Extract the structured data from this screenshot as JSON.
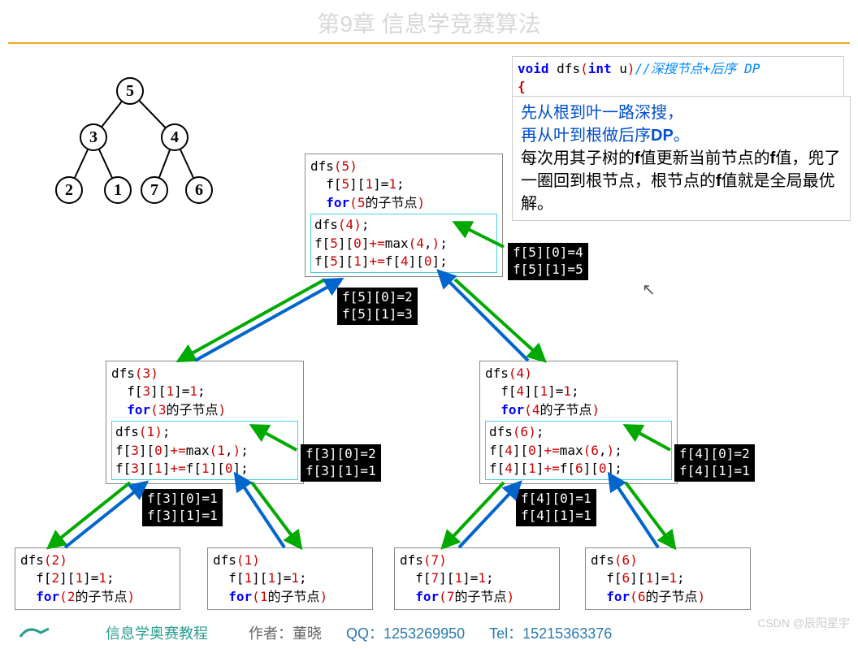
{
  "title": "第9章 信息学竞赛算法",
  "tree": {
    "root": "5",
    "left": "3",
    "right": "4",
    "ll": "2",
    "lr": "1",
    "rl": "7",
    "rr": "6"
  },
  "code_top": {
    "sig": "void dfs(int u)",
    "comment": "//深搜节点+后序 DP",
    "brace": "{"
  },
  "note": {
    "l1": "先从根到叶一路深搜，",
    "l2a": "再从叶到根做后序",
    "l2b": "DP",
    "l2c": "。",
    "l3a": "每次用其子树的",
    "l3b": "f",
    "l3c": "值更新当前节点的",
    "l3d": "f",
    "l3e": "值，兜了一圈回到根节点，根节点的",
    "l3f": "f",
    "l3g": "值就是全局最优解。"
  },
  "dfs5": {
    "h": "dfs(5)",
    "l1": "f[5][1]=1;",
    "l2a": "for",
    "l2b": "(5的子节点)",
    "in1": "dfs(4);",
    "in2": "f[5][0]+=max(4,);",
    "in3": "f[5][1]+=f[4][0];"
  },
  "black5a": {
    "l1": "f[5][0]=4",
    "l2": "f[5][1]=5"
  },
  "black5b": {
    "l1": "f[5][0]=2",
    "l2": "f[5][1]=3"
  },
  "dfs3": {
    "h": "dfs(3)",
    "l1": "f[3][1]=1;",
    "l2a": "for",
    "l2b": "(3的子节点)",
    "in1": "dfs(1);",
    "in2": "f[3][0]+=max(1,);",
    "in3": "f[3][1]+=f[1][0];"
  },
  "black3a": {
    "l1": "f[3][0]=2",
    "l2": "f[3][1]=1"
  },
  "black3b": {
    "l1": "f[3][0]=1",
    "l2": "f[3][1]=1"
  },
  "dfs4": {
    "h": "dfs(4)",
    "l1": "f[4][1]=1;",
    "l2a": "for",
    "l2b": "(4的子节点)",
    "in1": "dfs(6);",
    "in2": "f[4][0]+=max(6,);",
    "in3": "f[4][1]+=f[6][0];"
  },
  "black4a": {
    "l1": "f[4][0]=2",
    "l2": "f[4][1]=1"
  },
  "black4b": {
    "l1": "f[4][0]=1",
    "l2": "f[4][1]=1"
  },
  "dfs2": {
    "h": "dfs(2)",
    "l1": "f[2][1]=1;",
    "l2a": "for",
    "l2b": "(2的子节点)"
  },
  "dfs1": {
    "h": "dfs(1)",
    "l1": "f[1][1]=1;",
    "l2a": "for",
    "l2b": "(1的子节点)"
  },
  "dfs7": {
    "h": "dfs(7)",
    "l1": "f[7][1]=1;",
    "l2a": "for",
    "l2b": "(7的子节点)"
  },
  "dfs6": {
    "h": "dfs(6)",
    "l1": "f[6][1]=1;",
    "l2a": "for",
    "l2b": "(6的子节点)"
  },
  "footer": {
    "brand": "信息学奥赛教程",
    "author_label": "作者：",
    "author": "董晓",
    "qq_label": "QQ：",
    "qq": "1253269950",
    "tel_label": "Tel：",
    "tel": "15215363376"
  },
  "watermark": "CSDN @辰阳星宇"
}
